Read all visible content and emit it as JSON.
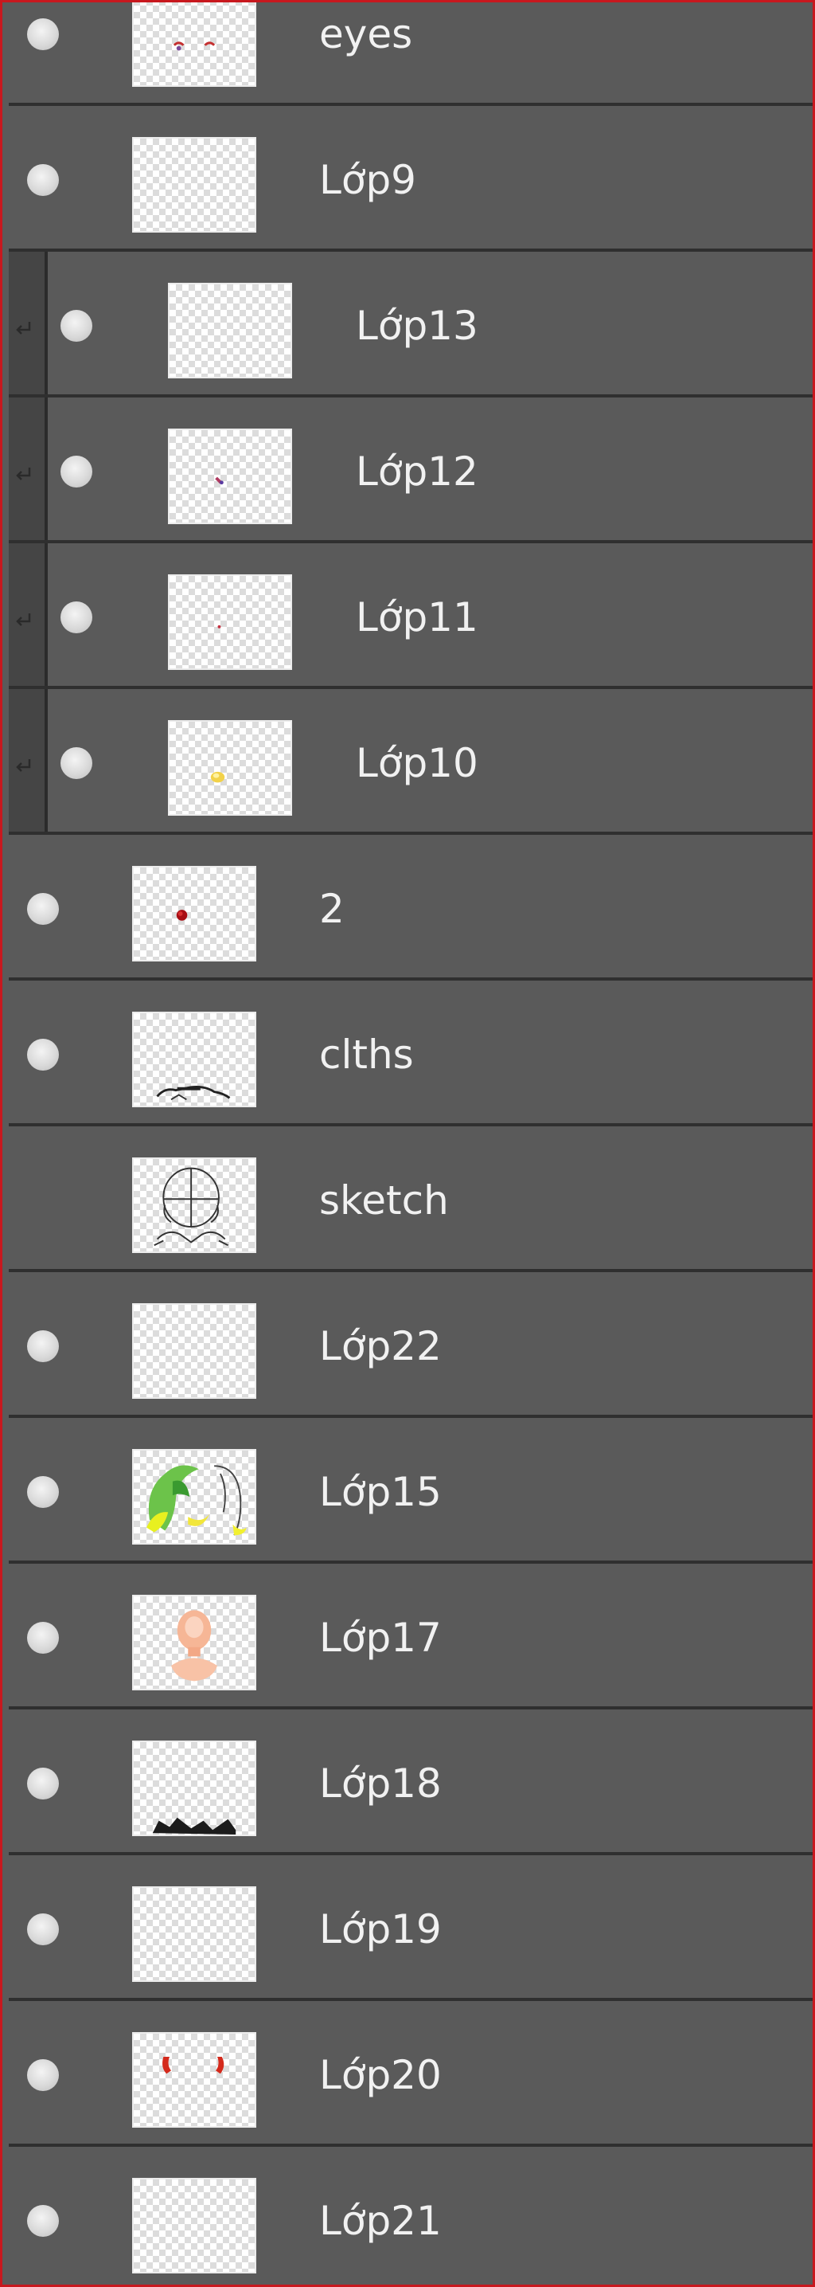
{
  "layers_panel": {
    "layers": [
      {
        "name": "eyes",
        "visible": true,
        "clipped": false,
        "thumbnail": "eyes"
      },
      {
        "name": "Lớp9",
        "visible": true,
        "clipped": false,
        "thumbnail": "empty"
      },
      {
        "name": "Lớp13",
        "visible": true,
        "clipped": true,
        "thumbnail": "empty"
      },
      {
        "name": "Lớp12",
        "visible": true,
        "clipped": true,
        "thumbnail": "small-mark"
      },
      {
        "name": "Lớp11",
        "visible": true,
        "clipped": true,
        "thumbnail": "tiny-dot"
      },
      {
        "name": "Lớp10",
        "visible": true,
        "clipped": true,
        "thumbnail": "yellow-spot"
      },
      {
        "name": "2",
        "visible": true,
        "clipped": false,
        "thumbnail": "red-dot"
      },
      {
        "name": "clths",
        "visible": true,
        "clipped": false,
        "thumbnail": "clothes"
      },
      {
        "name": "sketch",
        "visible": false,
        "clipped": false,
        "thumbnail": "sketch"
      },
      {
        "name": "Lớp22",
        "visible": true,
        "clipped": false,
        "thumbnail": "empty"
      },
      {
        "name": "Lớp15",
        "visible": true,
        "clipped": false,
        "thumbnail": "hair-green"
      },
      {
        "name": "Lớp17",
        "visible": true,
        "clipped": false,
        "thumbnail": "skin"
      },
      {
        "name": "Lớp18",
        "visible": true,
        "clipped": false,
        "thumbnail": "dark-bottom"
      },
      {
        "name": "Lớp19",
        "visible": true,
        "clipped": false,
        "thumbnail": "empty"
      },
      {
        "name": "Lớp20",
        "visible": true,
        "clipped": false,
        "thumbnail": "red-marks"
      },
      {
        "name": "Lớp21",
        "visible": true,
        "clipped": false,
        "thumbnail": "empty"
      }
    ]
  },
  "colors": {
    "panel_bg": "#5a5a5a",
    "row_separator": "#2f2f2f",
    "selection_border": "#c8181e",
    "label_text": "#f1f1f1",
    "clip_indent": "#454545"
  },
  "icons": {
    "visibility": "eye-icon",
    "clipping": "clipping-mask-icon"
  }
}
